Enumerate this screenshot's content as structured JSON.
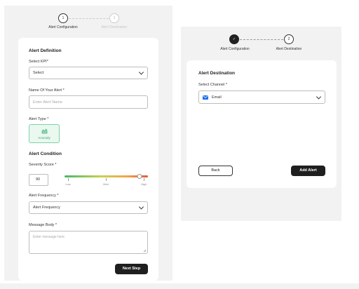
{
  "left": {
    "stepper": {
      "step1_number": "1",
      "step2_number": "2",
      "step1_label": "Alert Configuration",
      "step2_label": "Alert Destination"
    },
    "definition_title": "Alert Definition",
    "kpi_label": "Select KPI",
    "kpi_required": "*",
    "kpi_value": "Select",
    "name_label": "Name Of Your Alert",
    "name_required": "*",
    "name_placeholder": "Enter Alert Name",
    "type_label": "Alert Type",
    "type_required": "*",
    "type_option": "Anomaly",
    "condition_title": "Alert Condition",
    "severity_label": "Severity Score",
    "severity_required": "*",
    "severity_value": "90",
    "severity_fraction": 0.9,
    "severity_ticks": [
      "Low",
      "Med",
      "High"
    ],
    "frequency_label": "Alert Frequency",
    "frequency_required": "*",
    "frequency_value": "Alert Frequency",
    "message_label": "Message Body",
    "message_required": "*",
    "message_placeholder": "Enter message here",
    "next_button": "Next Step"
  },
  "right": {
    "stepper": {
      "step1_check": "✓",
      "step2_number": "2",
      "step1_label": "Alert Configuration",
      "step2_label": "Alert Destination"
    },
    "destination_title": "Alert Destination",
    "channel_label": "Select Channel",
    "channel_required": "*",
    "channel_value": "Email",
    "back_button": "Back",
    "add_button": "Add Alert"
  },
  "colors": {
    "accent_dark": "#1f1f1f",
    "anomaly_green": "#3aa873",
    "email_blue": "#1a73e8"
  }
}
